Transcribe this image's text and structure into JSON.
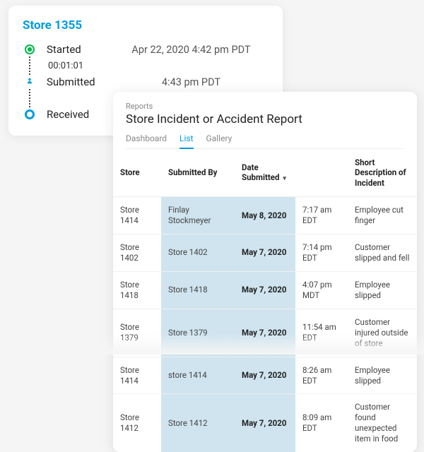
{
  "timeline": {
    "store_title": "Store 1355",
    "steps": [
      {
        "label": "Started",
        "time": "Apr 22, 2020 4:42 pm PDT"
      },
      {
        "label": "Submitted",
        "time": "4:43 pm PDT"
      },
      {
        "label": "Received",
        "time": ""
      }
    ],
    "duration": "00:01:01"
  },
  "report": {
    "breadcrumb": "Reports",
    "title": "Store Incident or Accident Report",
    "tabs": [
      {
        "label": "Dashboard",
        "active": false
      },
      {
        "label": "List",
        "active": true
      },
      {
        "label": "Gallery",
        "active": false
      }
    ],
    "columns": {
      "store": "Store",
      "submitted_by": "Submitted By",
      "date_submitted": "Date Submitted",
      "description": "Short Description of Incident"
    },
    "rows": [
      {
        "store": "Store 1414",
        "submitted_by": "Finlay Stockmeyer",
        "date": "May 8, 2020",
        "time": "7:17 am EDT",
        "desc": "Employee cut finger"
      },
      {
        "store": "Store 1402",
        "submitted_by": "Store 1402",
        "date": "May 7, 2020",
        "time": "7:14 pm EDT",
        "desc": "Customer slipped and fell"
      },
      {
        "store": "Store 1418",
        "submitted_by": "Store 1418",
        "date": "May 7, 2020",
        "time": "4:07 pm MDT",
        "desc": "Employee slipped"
      },
      {
        "store": "Store 1379",
        "submitted_by": "Store 1379",
        "date": "May 7, 2020",
        "time": "11:54 am EDT",
        "desc": "Customer injured outside of store"
      },
      {
        "store": "Store 1414",
        "submitted_by": "store 1414",
        "date": "May 7, 2020",
        "time": "8:26 am EDT",
        "desc": "Employee slipped"
      },
      {
        "store": "Store 1412",
        "submitted_by": "Store 1412",
        "date": "May 7, 2020",
        "time": "8:09 am EDT",
        "desc": "Customer found unexpected item in food"
      }
    ]
  }
}
